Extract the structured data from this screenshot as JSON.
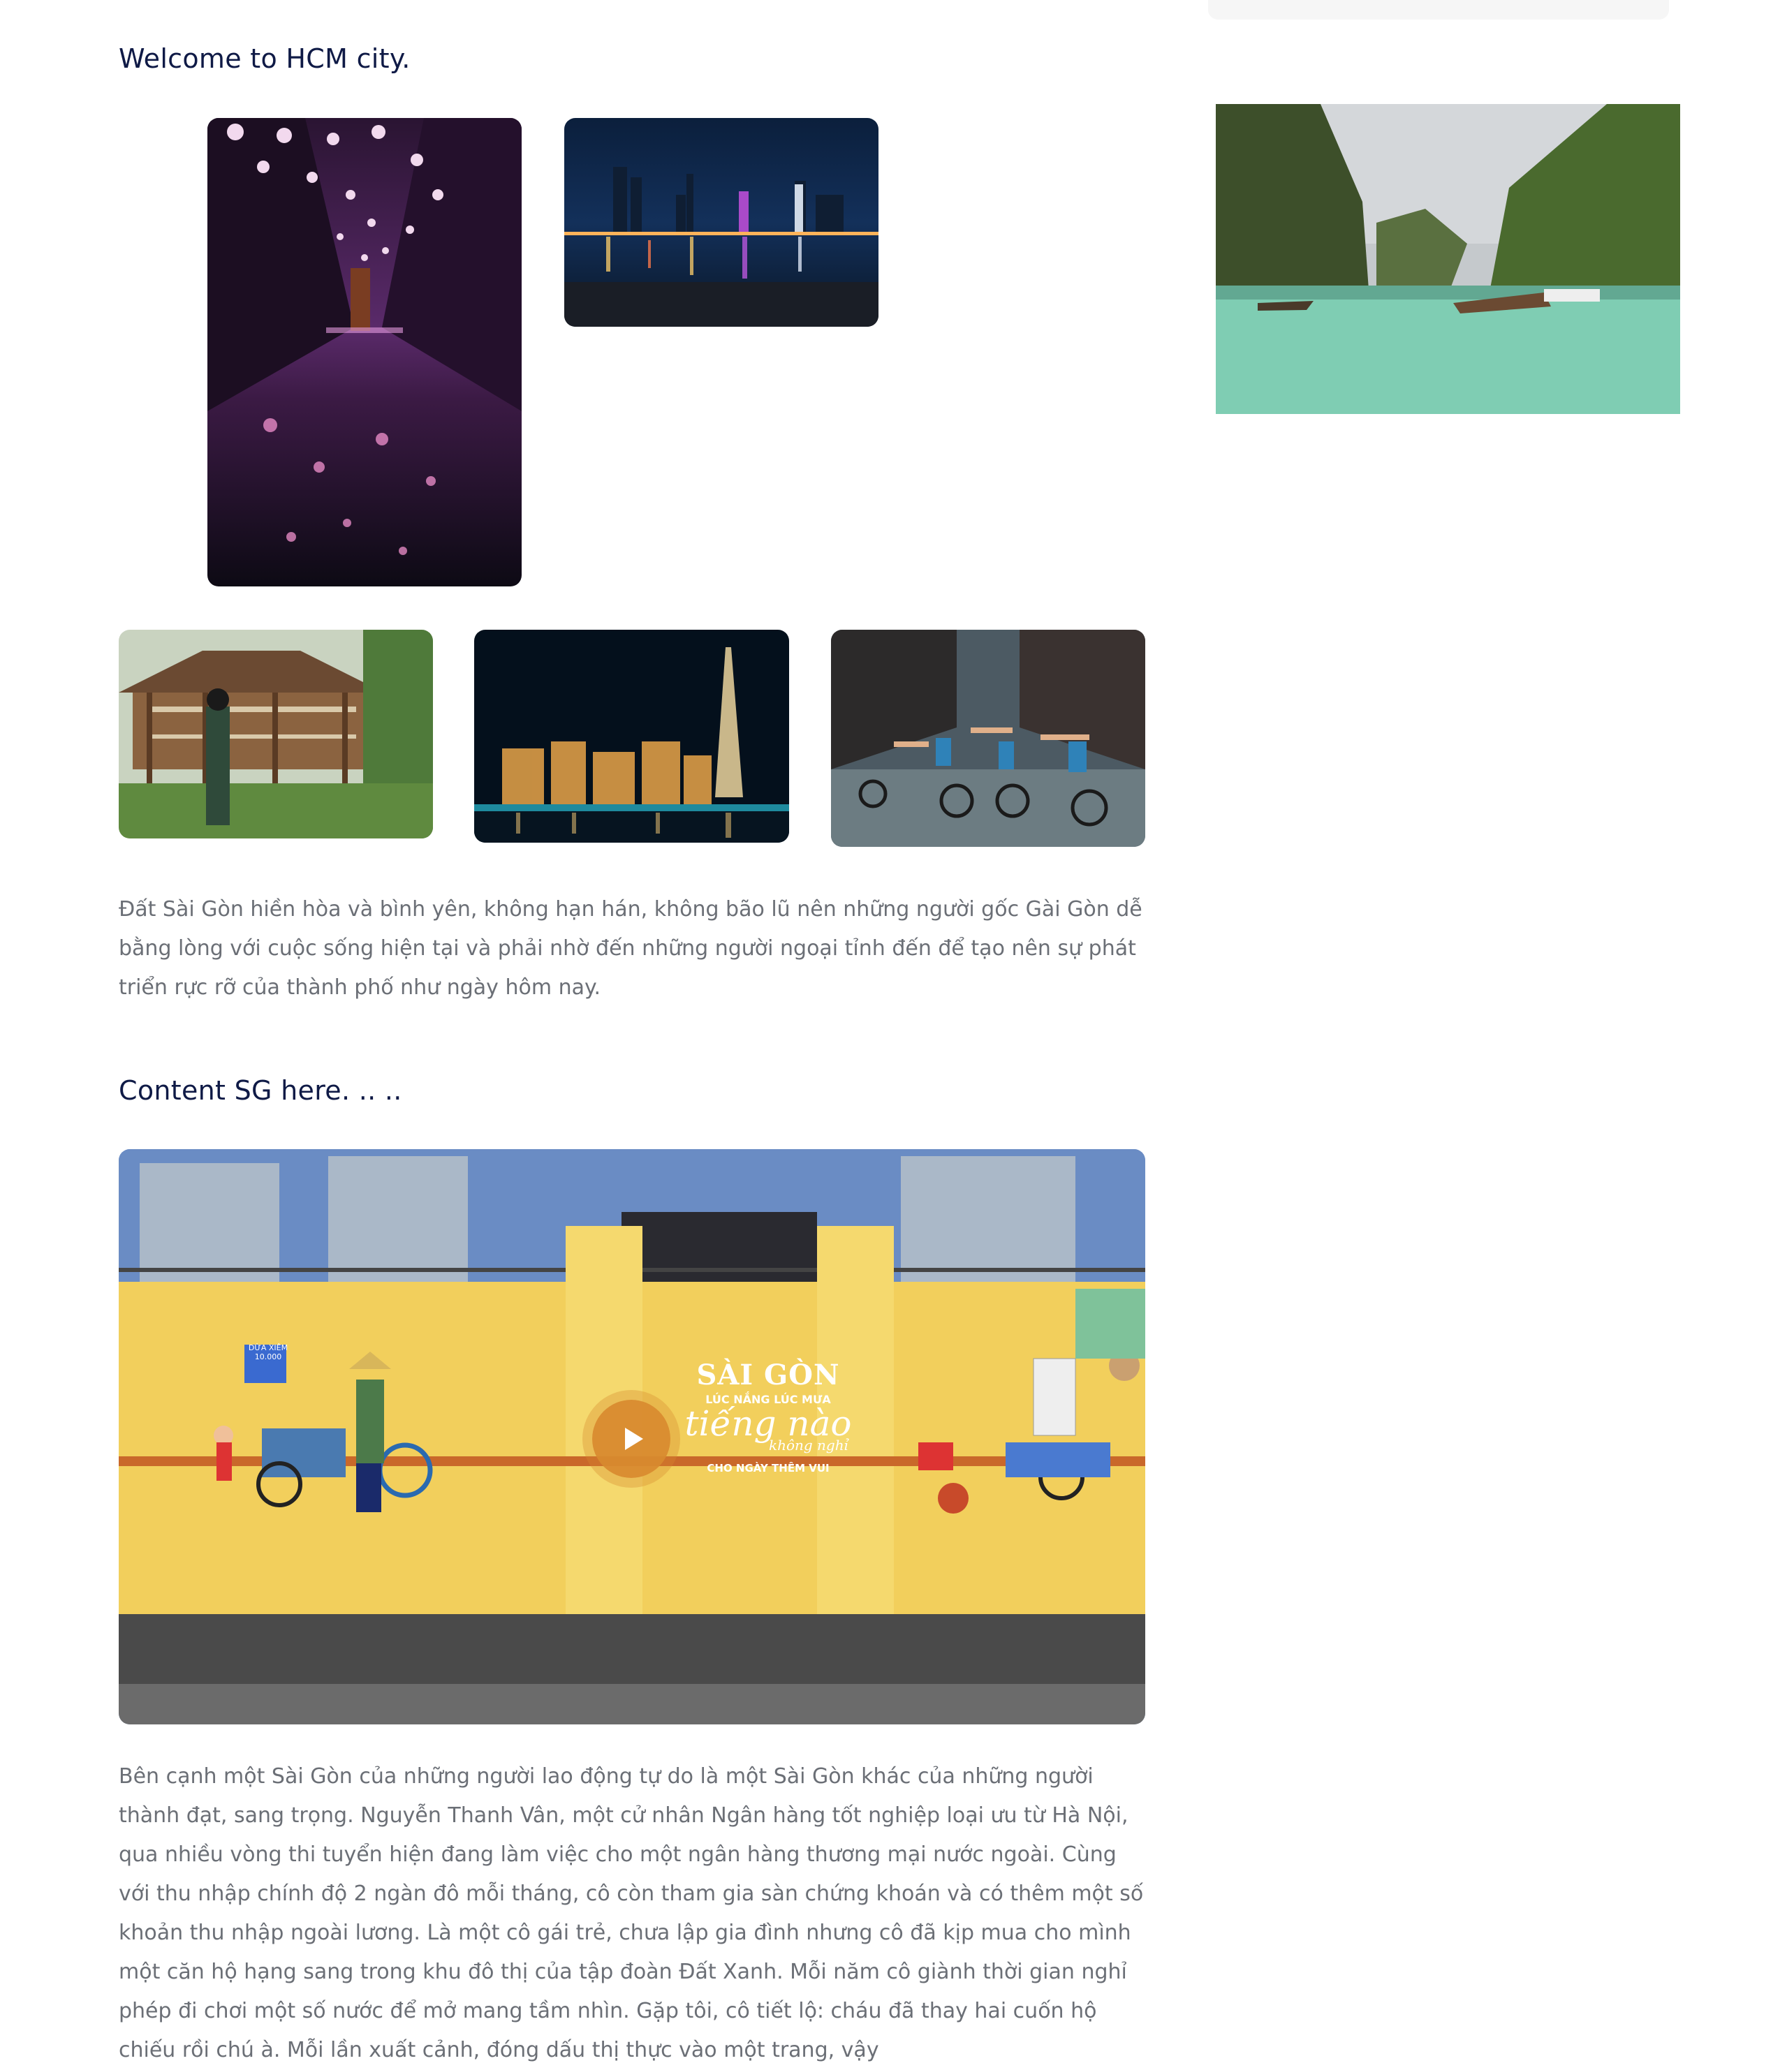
{
  "sections": [
    {
      "title": "Welcome to HCM city.",
      "paragraph": "Đất Sài Gòn hiền hòa và bình yên, không hạn hán, không bão lũ nên những người gốc Gài Gòn dễ bằng lòng với cuộc sống hiện tại và phải nhờ đến những người ngoại tỉnh đến để tạo nên sự phát triển rực rỡ của thành phố như ngày hôm nay."
    },
    {
      "title": "Content SG here. .. ..",
      "paragraph": "Bên cạnh một Sài Gòn của những người lao động tự do là một Sài Gòn khác của những người thành đạt, sang trọng. Nguyễn Thanh Vân, một cử nhân Ngân hàng tốt nghiệp loại ưu từ Hà Nội, qua nhiều vòng thi tuyển hiện đang làm việc cho một ngân hàng thương mại nước ngoài. Cùng với thu nhập chính độ 2 ngàn đô mỗi tháng, cô còn tham gia sàn chứng khoán và có thêm một số khoản thu nhập ngoài lương. Là một cô gái trẻ, chưa lập gia đình nhưng cô đã kịp mua cho mình một căn hộ hạng sang trong khu đô thị của tập đoàn Đất Xanh. Mỗi năm cô giành thời gian nghỉ phép đi chơi một số nước để mở mang tầm nhìn. Gặp tôi, cô tiết lộ: cháu đã thay hai cuốn hộ chiếu rồi chú à. Mỗi lần xuất cảnh, đóng dấu thị thực vào một trang, vậy"
    }
  ],
  "mural": {
    "title": "SÀI GÒN",
    "subtitle": "LÚC NẮNG LÚC MƯA",
    "script": "tiếng nào",
    "script_small": "không nghỉ",
    "tagline": "CHO NGÀY THÊM VUI",
    "sign_top": "DỪA XIÊM",
    "sign_bottom": "10.000"
  },
  "colors": {
    "heading": "#0f1a46",
    "body": "#6b6f76",
    "play_button": "#d88a2e"
  },
  "icons": {
    "play": "play-icon"
  }
}
